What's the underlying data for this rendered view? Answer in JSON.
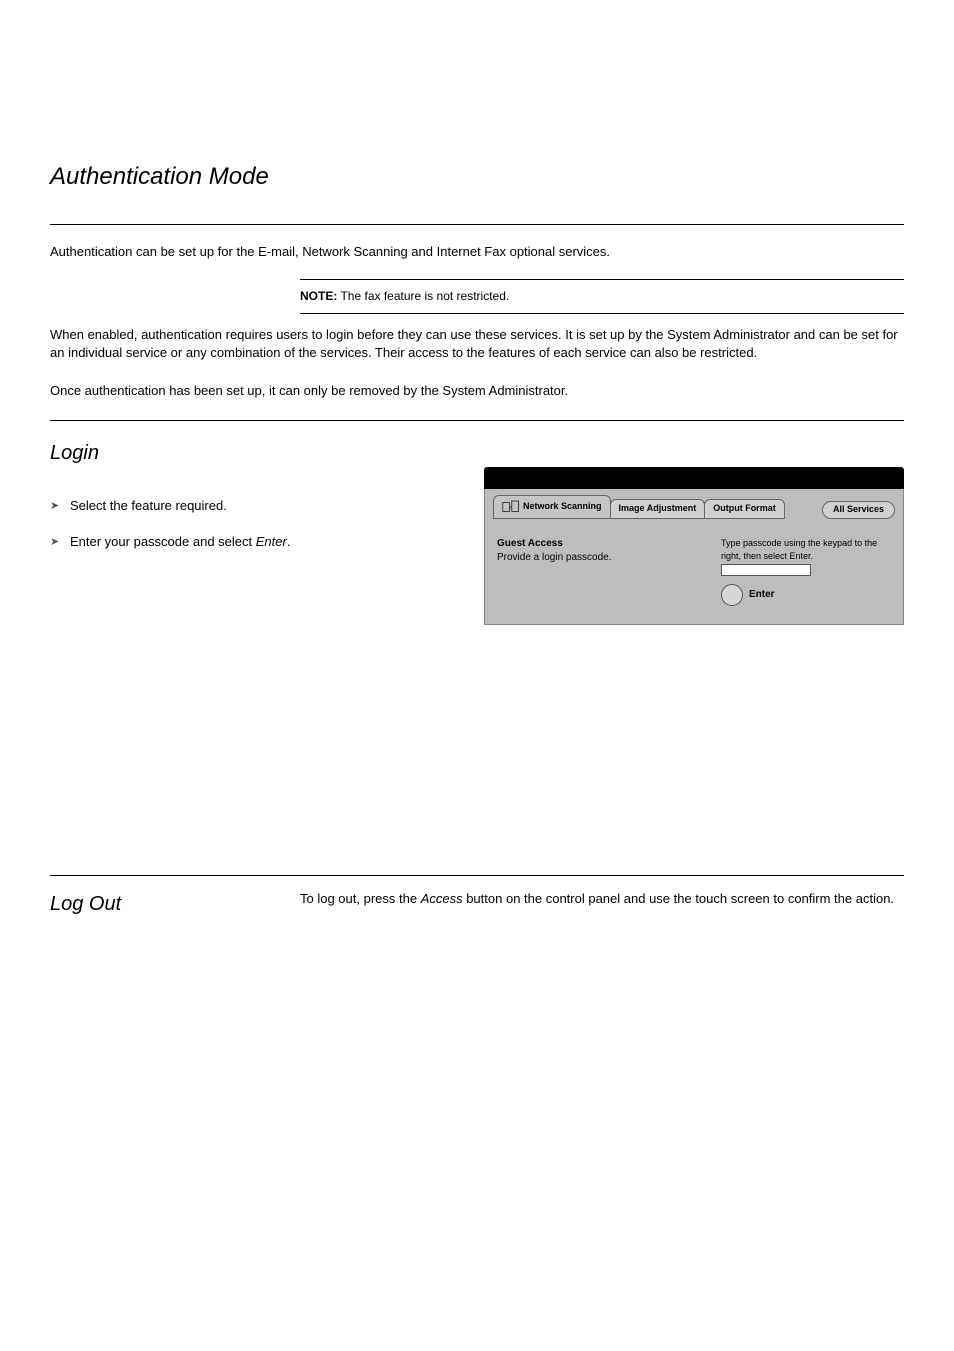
{
  "title": "Authentication Mode",
  "intro": "Authentication can be set up for the E-mail, Network Scanning and Internet Fax optional services.",
  "note": {
    "label": "NOTE:",
    "text": "The fax feature is not restricted."
  },
  "body1": "When enabled, authentication requires users to login before they can use these services. It is set up by the System Administrator and can be set for an individual service or any combination of the services. Their access to the features of each service can also be restricted.",
  "body2": "Once authentication has been set up, it can only be removed by the System Administrator.",
  "login": {
    "heading": "Login",
    "bullet1": "Select the feature required.",
    "bullet2_a": "Enter your passcode ",
    "bullet2_b": "and select ",
    "bullet2_enter": "Enter",
    "bullet2_c": "."
  },
  "screenshot": {
    "tab_network": "Network Scanning",
    "tab_image": "Image Adjustment",
    "tab_output": "Output Format",
    "tab_all": "All Services",
    "guest_title": "Guest Access",
    "guest_sub": "Provide a login passcode.",
    "instruction": "Type passcode using the keypad to the right, then select Enter.",
    "enter": "Enter"
  },
  "logout": {
    "heading": "Log Out",
    "text_a": "To log out, press the ",
    "text_access": "Access",
    "text_b": " button on the control panel and use the touch screen to confirm the action."
  }
}
